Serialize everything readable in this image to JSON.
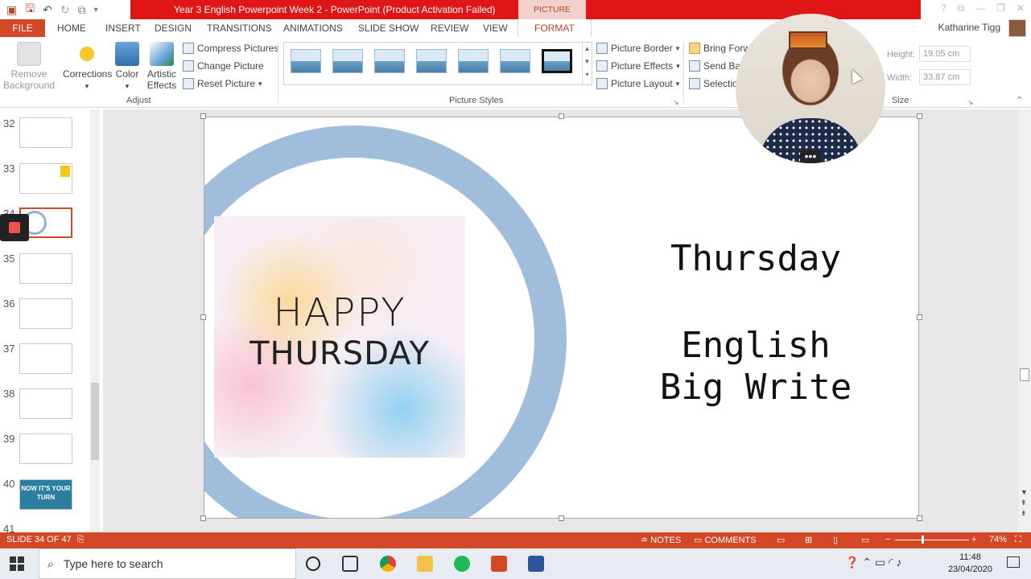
{
  "window": {
    "title": "Year 3 English Powerpoint Week 2 -  PowerPoint (Product Activation Failed)",
    "context_tab_header": "PICTURE TOOLS",
    "user_name": "Katharine Tigg"
  },
  "ribbon_tabs": [
    "FILE",
    "HOME",
    "INSERT",
    "DESIGN",
    "TRANSITIONS",
    "ANIMATIONS",
    "SLIDE SHOW",
    "REVIEW",
    "VIEW",
    "FORMAT"
  ],
  "ribbon": {
    "remove_background": "Remove Background",
    "corrections": "Corrections",
    "color": "Color",
    "artistic_effects": "Artistic Effects",
    "compress_pictures": "Compress Pictures",
    "change_picture": "Change Picture",
    "reset_picture": "Reset Picture",
    "adjust_group": "Adjust",
    "picture_styles_group": "Picture Styles",
    "picture_border": "Picture Border",
    "picture_effects": "Picture Effects",
    "picture_layout": "Picture Layout",
    "bring_forward": "Bring Forw",
    "send_backward": "Send Bac",
    "selection_pane": "Selection",
    "height_label": "Height:",
    "height_value": "19.05 cm",
    "width_label": "Width:",
    "width_value": "33.87 cm",
    "size_group": "Size"
  },
  "slides_pane": {
    "numbers": [
      "32",
      "33",
      "34",
      "35",
      "36",
      "37",
      "38",
      "39",
      "40",
      "41"
    ],
    "selected": "34",
    "thumb40_text": "NOW IT'S YOUR TURN"
  },
  "slide": {
    "image_line1": "HAPPY",
    "image_line2": "THURSDAY",
    "day": "Thursday",
    "subject_line1": "English",
    "subject_line2": "Big Write"
  },
  "status_bar": {
    "slide_indicator": "SLIDE 34 OF 47",
    "notes": "NOTES",
    "comments": "COMMENTS",
    "zoom": "74%"
  },
  "taskbar": {
    "search_placeholder": "Type here to search",
    "time": "11:48",
    "date": "23/04/2020"
  },
  "colors": {
    "accent": "#d24726",
    "title_bar_red": "#e01616",
    "ring_blue": "#8fb2d6"
  }
}
